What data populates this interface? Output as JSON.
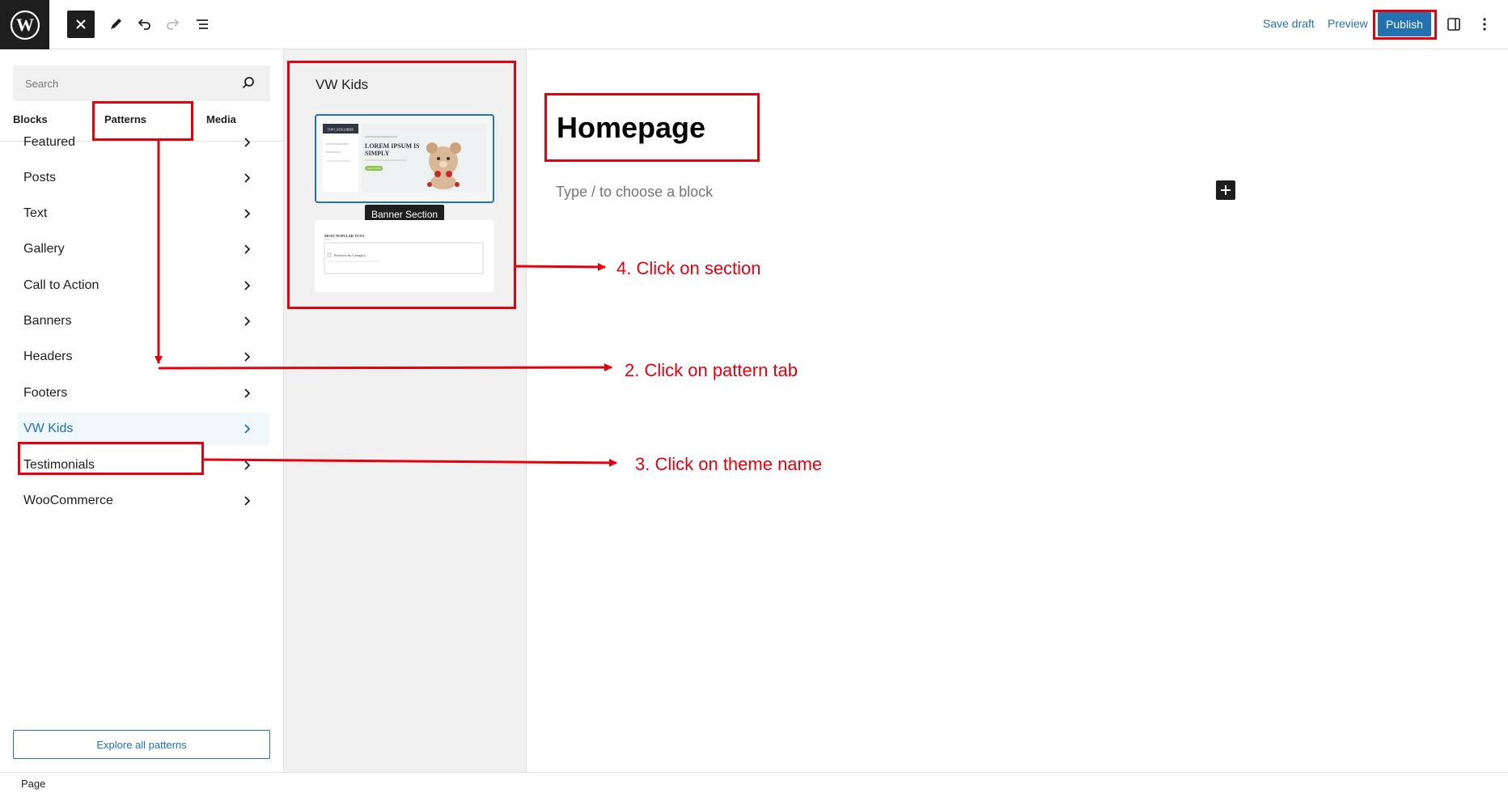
{
  "topbar": {
    "logo_icon": "wordpress-logo-icon",
    "close_icon": "close-icon",
    "tools_icon": "pencil-icon",
    "undo_icon": "undo-icon",
    "redo_icon": "redo-icon",
    "list_view_icon": "list-view-icon",
    "save_draft": "Save draft",
    "preview": "Preview",
    "publish": "Publish",
    "settings_icon": "sidebar-toggle-icon",
    "options_icon": "more-vertical-icon"
  },
  "inserter": {
    "search_placeholder": "Search",
    "tabs": [
      "Blocks",
      "Patterns",
      "Media"
    ],
    "categories": [
      {
        "label": "Featured",
        "active": false
      },
      {
        "label": "Posts",
        "active": false
      },
      {
        "label": "Text",
        "active": false
      },
      {
        "label": "Gallery",
        "active": false
      },
      {
        "label": "Call to Action",
        "active": false
      },
      {
        "label": "Banners",
        "active": false
      },
      {
        "label": "Headers",
        "active": false
      },
      {
        "label": "Footers",
        "active": false
      },
      {
        "label": "VW Kids",
        "active": true
      },
      {
        "label": "Testimonials",
        "active": false
      },
      {
        "label": "WooCommerce",
        "active": false
      }
    ],
    "explore_button": "Explore all patterns"
  },
  "patterns": {
    "category_title": "VW Kids",
    "tooltip": "Banner Section",
    "card1": {
      "sidebar_heading": "TOP CATEGORIES",
      "headline_line1": "LOREM IPSUM IS",
      "headline_line2": "SIMPLY",
      "cta": "SHOP NOW"
    },
    "card2": {
      "heading": "MOST POPULAR TOYS",
      "row_label": "Products by Category"
    }
  },
  "editor": {
    "title": "Homepage",
    "placeholder": "Type / to choose a block",
    "add_block_icon": "plus-icon"
  },
  "footer": {
    "breadcrumb": "Page"
  },
  "annotations": {
    "step2": "2. Click on pattern tab",
    "step3": "3. Click on theme name",
    "step4": "4. Click on section",
    "color": "#e3000f"
  },
  "colors": {
    "accent": "#2271b1",
    "dark": "#1e1e1e",
    "annotation_red": "#e3000f"
  }
}
